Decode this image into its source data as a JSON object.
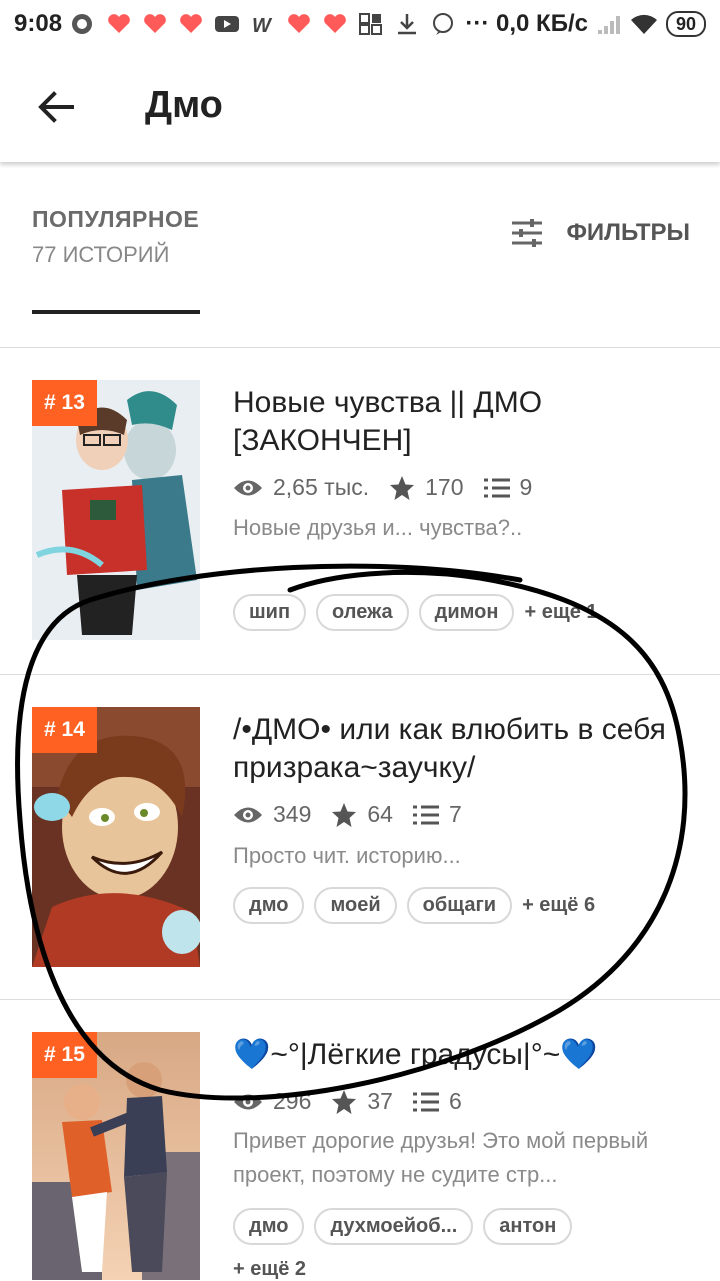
{
  "status_bar": {
    "time": "9:08",
    "net_speed": "··· 0,0 КБ/с",
    "battery": "90",
    "icons": [
      "messenger-icon",
      "heart-app-icon",
      "heart-app-icon",
      "heart-app-icon",
      "youtube-icon",
      "w-app-icon",
      "heart-app-icon",
      "heart-app-icon",
      "grid-icon",
      "download-icon",
      "viber-icon"
    ]
  },
  "app_bar": {
    "title": "Дмо"
  },
  "section": {
    "title": "ПОПУЛЯРНОЕ",
    "subtitle": "77 ИСТОРИЙ",
    "filters_label": "ФИЛЬТРЫ"
  },
  "stories": [
    {
      "rank": "# 13",
      "title": "Новые чувства || ДМО [ЗАКОНЧЕН]",
      "views": "2,65 тыс.",
      "votes": "170",
      "parts": "9",
      "description": "Новые друзья и... чувства?..",
      "tags": [
        "шип",
        "олежа",
        "димон"
      ],
      "more": "+ ещё 1",
      "cover_colors": [
        "#e9eef2",
        "#c8302a",
        "#2f8c8a"
      ]
    },
    {
      "rank": "# 14",
      "title": "/•ДМО• или как влюбить в себя призрака~заучку/",
      "views": "349",
      "votes": "64",
      "parts": "7",
      "description": "Просто чит. историю...",
      "tags": [
        "дмо",
        "моей",
        "общаги"
      ],
      "more": "+ ещё 6",
      "cover_colors": [
        "#5a2a1c",
        "#a84a2a",
        "#d9a27a"
      ]
    },
    {
      "rank": "# 15",
      "title": "💙~°|Лёгкие градусы|°~💙",
      "views": "296",
      "votes": "37",
      "parts": "6",
      "description": "Привет дорогие друзья! Это мой первый проект, поэтому не судите стр...",
      "tags": [
        "дмо",
        "духмоейоб...",
        "антон"
      ],
      "more": "+ ещё 2",
      "cover_colors": [
        "#e0b48a",
        "#f2c0a0",
        "#3a3f55"
      ]
    }
  ],
  "colors": {
    "rank_badge": "#ff6122",
    "annotation_stroke": "#000000"
  }
}
